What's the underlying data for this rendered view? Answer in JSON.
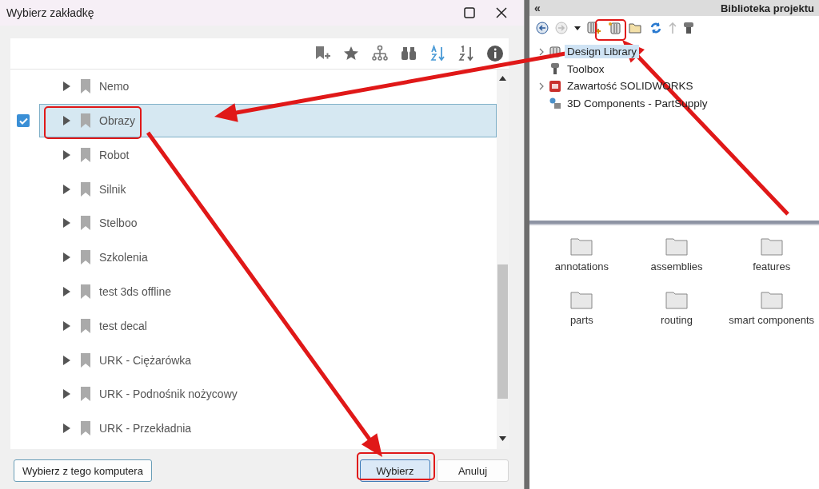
{
  "dialog": {
    "title": "Wybierz zakładkę",
    "bookmarks": [
      {
        "label": "Nemo",
        "selected": false
      },
      {
        "label": "Obrazy",
        "selected": true
      },
      {
        "label": "Robot",
        "selected": false
      },
      {
        "label": "Silnik",
        "selected": false
      },
      {
        "label": "Stelboo",
        "selected": false
      },
      {
        "label": "Szkolenia",
        "selected": false
      },
      {
        "label": "test 3ds offline",
        "selected": false
      },
      {
        "label": "test decal",
        "selected": false
      },
      {
        "label": "URK - Ciężarówka",
        "selected": false
      },
      {
        "label": "URK - Podnośnik nożycowy",
        "selected": false
      },
      {
        "label": "URK - Przekładnia",
        "selected": false
      }
    ],
    "buttons": [
      {
        "label": "Wybierz z tego komputera",
        "kind": "outline"
      },
      {
        "label": "Wybierz",
        "kind": "primary"
      },
      {
        "label": "Anuluj",
        "kind": "plain"
      }
    ]
  },
  "library": {
    "collapse": "«",
    "title": "Biblioteka projektu",
    "tree": [
      {
        "label": "Design Library",
        "expandable": true,
        "selected": true,
        "kind": "library"
      },
      {
        "label": "Toolbox",
        "expandable": false,
        "selected": false,
        "kind": "toolbox"
      },
      {
        "label": "Zawartość SOLIDWORKS",
        "expandable": true,
        "selected": false,
        "kind": "sw"
      },
      {
        "label": "3D Components - PartSupply",
        "expandable": false,
        "selected": false,
        "kind": "parts"
      }
    ],
    "folders": [
      "annotations",
      "assemblies",
      "features",
      "parts",
      "routing",
      "smart components"
    ]
  }
}
